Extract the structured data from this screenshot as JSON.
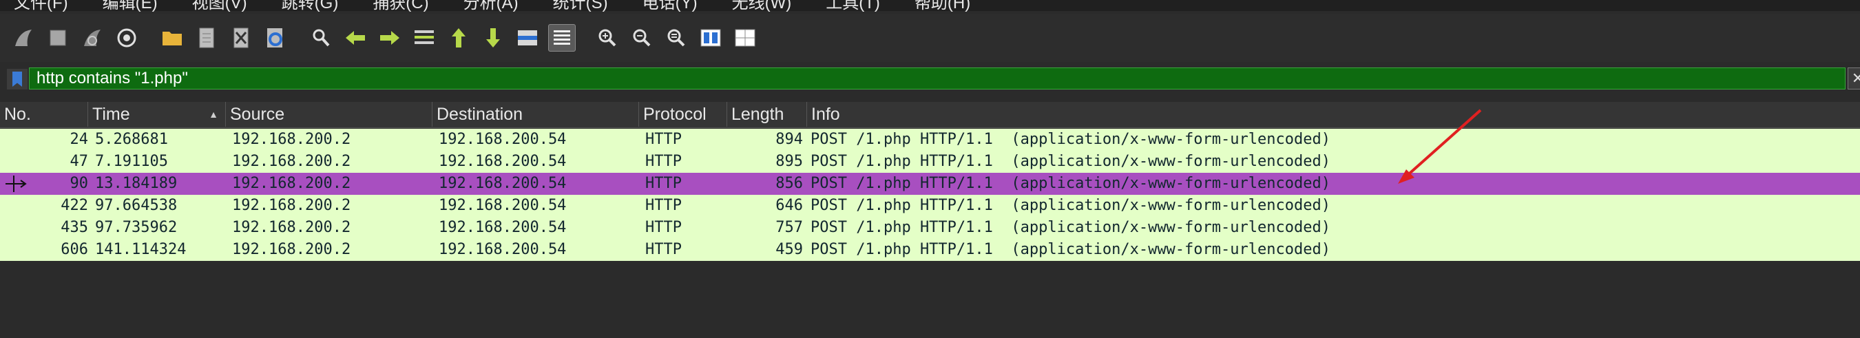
{
  "menu": {
    "items": [
      "文件(F)",
      "编辑(E)",
      "视图(V)",
      "跳转(G)",
      "捕获(C)",
      "分析(A)",
      "统计(S)",
      "电话(Y)",
      "无线(W)",
      "工具(T)",
      "帮助(H)"
    ]
  },
  "toolbar": {
    "icons": [
      "shark-fin-start-icon",
      "stop-square-icon",
      "restart-fin-icon",
      "gear-options-icon",
      "folder-open-icon",
      "file-icon",
      "close-file-icon",
      "reload-icon",
      "find-icon",
      "back-arrow-icon",
      "forward-arrow-icon",
      "go-to-packet-icon",
      "first-packet-icon",
      "last-packet-icon",
      "autoscroll-icon",
      "colorize-icon",
      "zoom-in-icon",
      "zoom-out-icon",
      "zoom-normal-icon",
      "resize-columns-icon",
      "expand-icon"
    ]
  },
  "filter": {
    "value": "http contains \"1.php\"",
    "clear_symbol": "✕"
  },
  "columns": {
    "no": "No.",
    "time": "Time",
    "source": "Source",
    "destination": "Destination",
    "protocol": "Protocol",
    "length": "Length",
    "info": "Info"
  },
  "packets": [
    {
      "no": "24",
      "time": "5.268681",
      "source": "192.168.200.2",
      "destination": "192.168.200.54",
      "protocol": "HTTP",
      "length": "894",
      "info": "POST /1.php HTTP/1.1  (application/x-www-form-urlencoded)"
    },
    {
      "no": "47",
      "time": "7.191105",
      "source": "192.168.200.2",
      "destination": "192.168.200.54",
      "protocol": "HTTP",
      "length": "895",
      "info": "POST /1.php HTTP/1.1  (application/x-www-form-urlencoded)"
    },
    {
      "no": "90",
      "time": "13.184189",
      "source": "192.168.200.2",
      "destination": "192.168.200.54",
      "protocol": "HTTP",
      "length": "856",
      "info": "POST /1.php HTTP/1.1  (application/x-www-form-urlencoded)"
    },
    {
      "no": "422",
      "time": "97.664538",
      "source": "192.168.200.2",
      "destination": "192.168.200.54",
      "protocol": "HTTP",
      "length": "646",
      "info": "POST /1.php HTTP/1.1  (application/x-www-form-urlencoded)"
    },
    {
      "no": "435",
      "time": "97.735962",
      "source": "192.168.200.2",
      "destination": "192.168.200.54",
      "protocol": "HTTP",
      "length": "757",
      "info": "POST /1.php HTTP/1.1  (application/x-www-form-urlencoded)"
    },
    {
      "no": "606",
      "time": "141.114324",
      "source": "192.168.200.2",
      "destination": "192.168.200.54",
      "protocol": "HTTP",
      "length": "459",
      "info": "POST /1.php HTTP/1.1  (application/x-www-form-urlencoded)"
    }
  ],
  "colors": {
    "row_bg": "#e4ffc7",
    "selected_row_bg": "#a84fc0",
    "filter_bg": "#0e6b10",
    "annotation_arrow": "#e02020"
  }
}
